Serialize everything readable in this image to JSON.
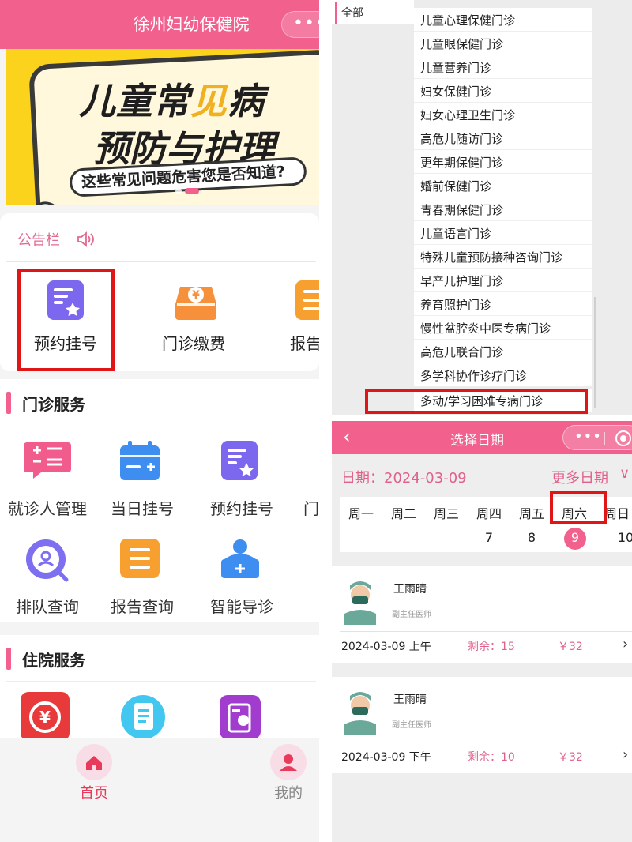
{
  "left": {
    "header_title": "徐州妇幼保健院",
    "capsule_dots": "•••",
    "banner": {
      "line1_a": "儿童常",
      "line1_hl": "见",
      "line1_b": "病",
      "line2": "预防与护理",
      "subtitle": "这些常见问题危害您是否知道?"
    },
    "notice_label": "公告栏",
    "quick_actions": [
      {
        "label": "预约挂号"
      },
      {
        "label": "门诊缴费"
      },
      {
        "label": "报告查"
      }
    ],
    "outpatient": {
      "title": "门诊服务",
      "items": [
        {
          "label": "就诊人管理"
        },
        {
          "label": "当日挂号"
        },
        {
          "label": "预约挂号"
        },
        {
          "label": "门"
        },
        {
          "label": "排队查询"
        },
        {
          "label": "报告查询"
        },
        {
          "label": "智能导诊"
        }
      ]
    },
    "inpatient": {
      "title": "住院服务"
    },
    "tabs": [
      {
        "label": "首页"
      },
      {
        "label": "我的"
      }
    ]
  },
  "departments": {
    "side_label": "全部",
    "items": [
      "儿童心理保健门诊",
      "儿童眼保健门诊",
      "儿童营养门诊",
      "妇女保健门诊",
      "妇女心理卫生门诊",
      "高危儿随访门诊",
      "更年期保健门诊",
      "婚前保健门诊",
      "青春期保健门诊",
      "儿童语言门诊",
      "特殊儿童预防接种咨询门诊",
      "早产儿护理门诊",
      "养育照护门诊",
      "慢性盆腔炎中医专病门诊",
      "高危儿联合门诊",
      "多学科协作诊疗门诊",
      "多动/学习困难专病门诊"
    ]
  },
  "date_page": {
    "back_icon": "‹",
    "title": "选择日期",
    "capsule_dots": "•••",
    "date_label": "日期：",
    "date_value": "2024-03-09",
    "more_dates": "更多日期",
    "more_chev": "∨",
    "weekdays": [
      "周一",
      "周二",
      "周三",
      "周四",
      "周五",
      "周六",
      "周日"
    ],
    "day_numbers": [
      "",
      "",
      "",
      "7",
      "8",
      "9",
      "10"
    ],
    "selected_day": "9",
    "doctors": [
      {
        "name": "王雨晴",
        "title": "副主任医师",
        "time": "2024-03-09 上午",
        "remaining": "剩余：15",
        "price": "￥32"
      },
      {
        "name": "王雨晴",
        "title": "副主任医师",
        "time": "2024-03-09 下午",
        "remaining": "剩余：10",
        "price": "￥32"
      }
    ]
  },
  "colors": {
    "brand_pink": "#f2608e",
    "highlight_red": "#e01616",
    "accent_text": "#e0628a"
  }
}
